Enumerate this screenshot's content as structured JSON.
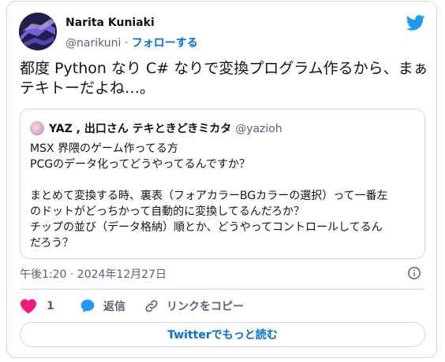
{
  "author": {
    "name": "Narita Kuniaki",
    "handle": "@narikuni",
    "separator": "·",
    "follow_label": "フォローする"
  },
  "tweet": {
    "text": "都度 Python なり C# なりで変換プログラム作るから、まぁテキトーだよね…。"
  },
  "quoted": {
    "name": "YAZ , 出口さん テキときどきミカタ",
    "handle": "@yazioh",
    "lines": [
      "MSX 界隈のゲーム作ってる方",
      "PCGのデータ化ってどうやってるんですか？",
      "",
      "まとめて変換する時、裏表（フォアカラーBGカラーの選択）って一番左",
      "のドットがどっちかって自動的に変換してるんだろか？",
      "チップの並び（データ格納）順とか、どうやってコントロールしてるん",
      "だろう？"
    ]
  },
  "timestamp": "午後1:20 · 2024年12月27日",
  "actions": {
    "like_count": "1",
    "reply_label": "返信",
    "copy_link_label": "リンクをコピー"
  },
  "read_more_label": "Twitterでもっと読む",
  "icons": {
    "brand": "twitter-bird-icon",
    "like": "heart-icon",
    "reply": "speech-bubble-icon",
    "copy": "link-icon",
    "info": "info-icon"
  },
  "colors": {
    "brand_blue": "#1d9bf0",
    "link_blue": "#006fd6",
    "like_red": "#f91880",
    "muted": "#536471",
    "border": "#cfd9de"
  }
}
